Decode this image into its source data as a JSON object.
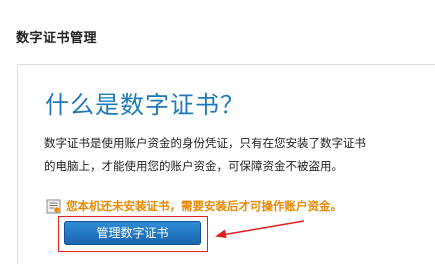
{
  "page": {
    "section_title": "数字证书管理"
  },
  "panel": {
    "heading": "什么是数字证书？",
    "description_line1": "数字证书是使用账户资金的身份凭证，只有在您安装了数字证书",
    "description_line2": "的电脑上，才能使用您的账户资金，可保障资金不被盗用。",
    "warning_icon": "certificate-warning-icon",
    "warning_text": "您本机还未安装证书，需要安装后才可操作账户资金。",
    "manage_button_label": "管理数字证书"
  },
  "colors": {
    "heading_blue": "#1f79b8",
    "warning_orange": "#e88a00",
    "button_blue": "#1a63ad",
    "annotation_red": "#e02020"
  }
}
